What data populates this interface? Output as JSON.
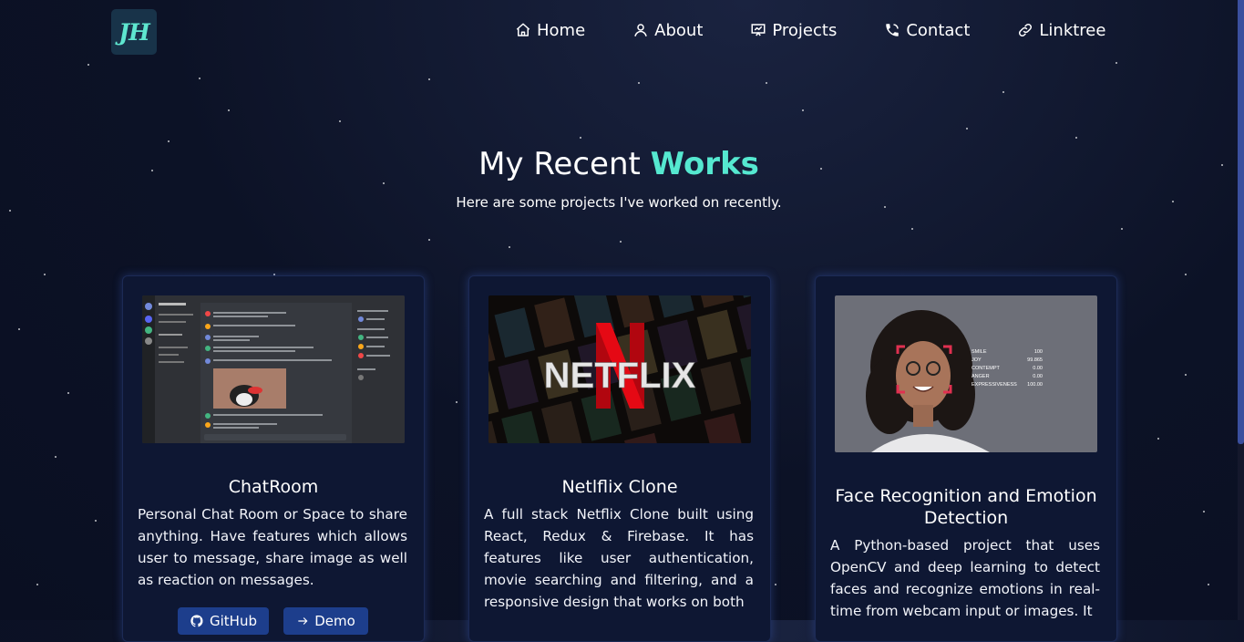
{
  "logo": {
    "text": "JH"
  },
  "nav": [
    {
      "label": "Home",
      "icon": "home-icon"
    },
    {
      "label": "About",
      "icon": "user-icon"
    },
    {
      "label": "Projects",
      "icon": "presentation-icon"
    },
    {
      "label": "Contact",
      "icon": "phone-icon"
    },
    {
      "label": "Linktree",
      "icon": "link-icon"
    }
  ],
  "section": {
    "title_plain": "My Recent",
    "title_accent": "Works",
    "subtitle": "Here are some projects I've worked on recently."
  },
  "projects": [
    {
      "title": "ChatRoom",
      "description": "Personal Chat Room or Space to share anything. Have features which allows user to message, share image as well as reaction on messages.",
      "buttons": [
        {
          "label": "GitHub",
          "icon": "github-icon"
        },
        {
          "label": "Demo",
          "icon": "demo-icon"
        }
      ]
    },
    {
      "title": "Netlflix Clone",
      "image_text": "NETFLIX",
      "description": "A full stack Netflix Clone built using React, Redux & Firebase. It has features like user authentication, movie searching and filtering, and a responsive design that works on both"
    },
    {
      "title": "Face Recognition and Emotion Detection",
      "description": "A Python-based project that uses OpenCV and deep learning to detect faces and recognize emotions in real-time from webcam input or images. It",
      "stats": [
        {
          "label": "SMILE",
          "value": "100"
        },
        {
          "label": "JOY",
          "value": "99.865"
        },
        {
          "label": "CONTEMPT",
          "value": "0.00"
        },
        {
          "label": "ANGER",
          "value": "0.00"
        },
        {
          "label": "EXPRESSIVENESS",
          "value": "100.00"
        }
      ]
    }
  ],
  "colors": {
    "accent": "#55e8d0",
    "background": "#0c1226",
    "card": "#0e1733",
    "button": "#1d3e8c"
  }
}
